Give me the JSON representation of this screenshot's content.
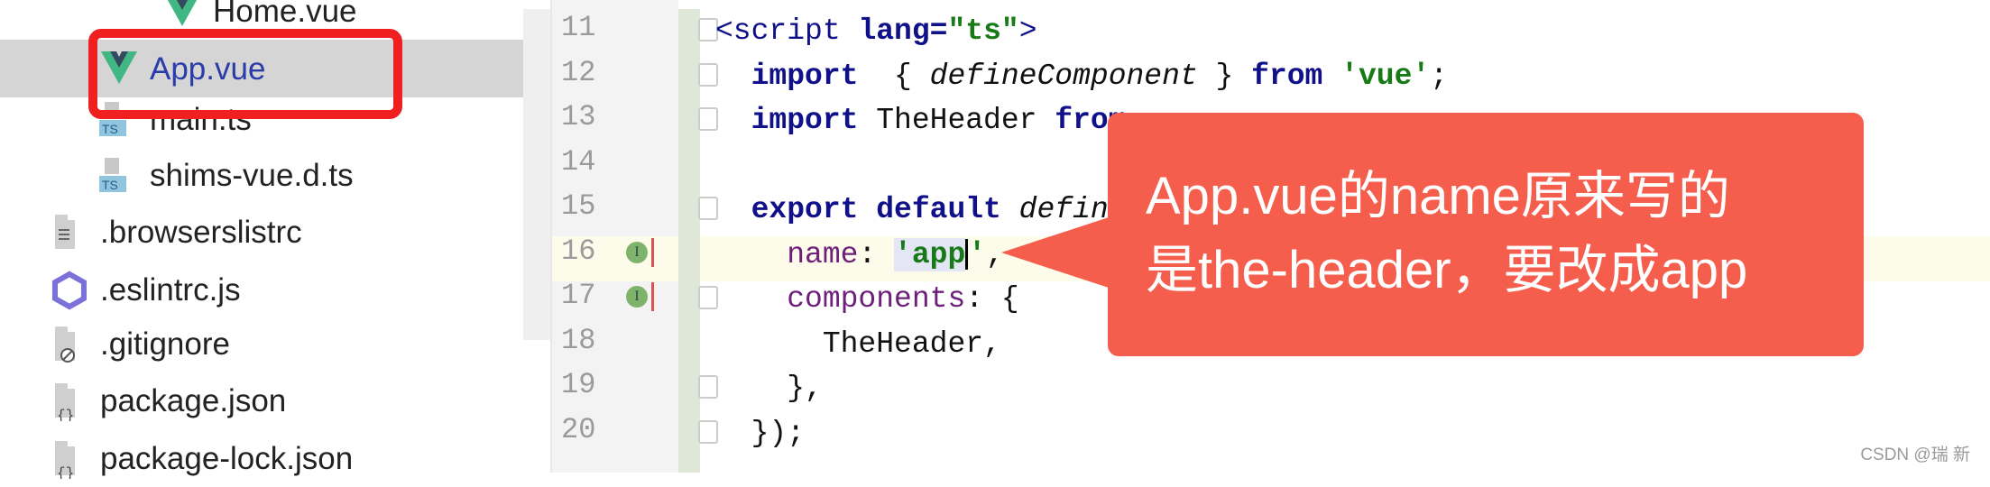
{
  "project_tree": {
    "items": [
      {
        "label": "Home.vue",
        "icon": "vue-icon"
      },
      {
        "label": "App.vue",
        "icon": "vue-icon",
        "selected": true
      },
      {
        "label": "main.ts",
        "icon": "ts-file-icon"
      },
      {
        "label": "shims-vue.d.ts",
        "icon": "ts-file-icon"
      },
      {
        "label": ".browserslistrc",
        "icon": "text-file-icon"
      },
      {
        "label": ".eslintrc.js",
        "icon": "eslint-icon"
      },
      {
        "label": ".gitignore",
        "icon": "ignore-file-icon"
      },
      {
        "label": "package.json",
        "icon": "json-file-icon"
      },
      {
        "label": "package-lock.json",
        "icon": "json-file-icon"
      }
    ],
    "ts_badge": "TS"
  },
  "editor": {
    "line_numbers": [
      "11",
      "12",
      "13",
      "14",
      "15",
      "16",
      "17",
      "18",
      "19",
      "20"
    ],
    "lines": [
      [
        [
          "t",
          "<script "
        ],
        [
          "k",
          "lang="
        ],
        [
          "s",
          "\"ts\""
        ],
        [
          "t",
          ">"
        ]
      ],
      [
        [
          "k",
          "  import"
        ],
        [
          "",
          "  { "
        ],
        [
          "i",
          "defineComponent"
        ],
        [
          "",
          " } "
        ],
        [
          "k",
          "from"
        ],
        [
          "",
          " "
        ],
        [
          "s",
          "'vue'"
        ],
        [
          "",
          ";"
        ]
      ],
      [
        [
          "k",
          "  import"
        ],
        [
          "",
          " TheHeader "
        ],
        [
          "k",
          "from"
        ]
      ],
      [],
      [
        [
          "k",
          "  export default"
        ],
        [
          "",
          " "
        ],
        [
          "i",
          "defin"
        ]
      ],
      [
        [
          "p",
          "    name"
        ],
        [
          "",
          ": "
        ],
        [
          "s",
          "'app"
        ],
        [
          "cursor",
          ""
        ],
        [
          "s",
          "'"
        ],
        [
          "",
          ","
        ]
      ],
      [
        [
          "p",
          "    components"
        ],
        [
          "",
          ": {"
        ]
      ],
      [
        [
          "",
          "      TheHeader,"
        ]
      ],
      [
        [
          "",
          "    },"
        ]
      ],
      [
        [
          "",
          "  });"
        ]
      ]
    ],
    "gutter_marker": "I"
  },
  "callout": {
    "line1": "App.vue的name原来写的",
    "line2": "是the-header，要改成app",
    "color": "#f55e4c"
  },
  "watermark": "CSDN @瑞 新"
}
